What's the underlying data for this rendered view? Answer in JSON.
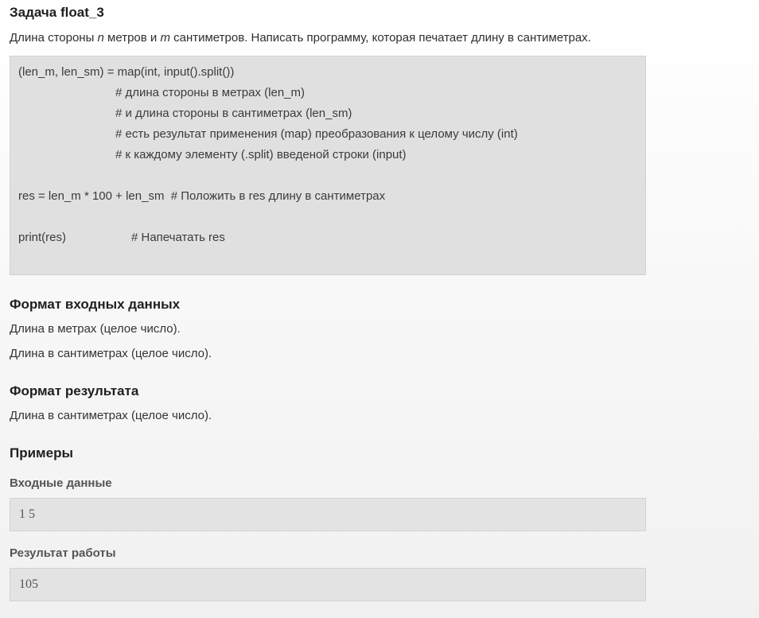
{
  "task": {
    "title": "Задача float_3",
    "statement": {
      "part1": "Длина стороны ",
      "var_n": "n",
      "part2": " метров и ",
      "var_m": "m",
      "part3": " сантиметров. Написать программу, которая печатает длину в сантиметрах."
    }
  },
  "code": {
    "lines": [
      "(len_m, len_sm) = map(int, input().split())",
      "# длина стороны в метрах (len_m)",
      "# и длина стороны в сантиметрах (len_sm)",
      "# есть результат применения (map) преобразования к целому числу (int)",
      "# к каждому элементу (.split) введеной строки (input)",
      "res = len_m * 100 + len_sm  # Положить в res длину в сантиметрах",
      "print(res)",
      "# Напечатать res"
    ]
  },
  "input_format": {
    "title": "Формат входных данных",
    "lines": [
      "Длина в метрах (целое число).",
      "Длина в сантиметрах (целое число)."
    ]
  },
  "output_format": {
    "title": "Формат результата",
    "lines": [
      "Длина в сантиметрах (целое число)."
    ]
  },
  "examples": {
    "title": "Примеры",
    "input_label": "Входные данные",
    "input_value": "1 5",
    "output_label": "Результат работы",
    "output_value": "105"
  }
}
